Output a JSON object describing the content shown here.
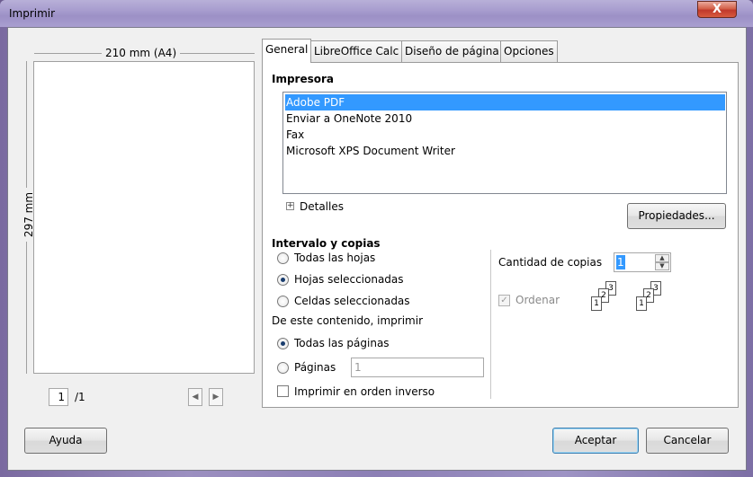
{
  "window": {
    "title": "Imprimir",
    "close_label": "X"
  },
  "preview": {
    "width_label": "210 mm (A4)",
    "height_label": "297 mm",
    "page_current": "1",
    "page_total": "/1",
    "prev_icon": "chevron-left-icon",
    "next_icon": "chevron-right-icon"
  },
  "tabs": [
    {
      "label": "General"
    },
    {
      "label": "LibreOffice Calc"
    },
    {
      "label": "Diseño de página"
    },
    {
      "label": "Opciones"
    }
  ],
  "printer": {
    "heading": "Impresora",
    "items": [
      {
        "label": "Adobe PDF",
        "selected": true
      },
      {
        "label": "Enviar a OneNote 2010"
      },
      {
        "label": "Fax"
      },
      {
        "label": "Microsoft XPS Document Writer"
      }
    ],
    "details_label": "Detalles",
    "properties_label": "Propiedades..."
  },
  "range": {
    "heading": "Intervalo y copias",
    "options": [
      {
        "label": "Todas las hojas"
      },
      {
        "label": "Hojas seleccionadas",
        "checked": true
      },
      {
        "label": "Celdas seleccionadas"
      }
    ],
    "content_heading": "De este contenido, imprimir",
    "content_options": [
      {
        "label": "Todas las páginas",
        "checked": true
      },
      {
        "label": "Páginas"
      }
    ],
    "pages_value": "1",
    "reverse_label": "Imprimir en orden inverso"
  },
  "copies": {
    "label": "Cantidad de copias",
    "value": "1",
    "collate_label": "Ordenar",
    "collate_check": "✓",
    "doc_numbers": [
      "1",
      "2",
      "3"
    ]
  },
  "footer": {
    "help_label": "Ayuda",
    "ok_label": "Aceptar",
    "cancel_label": "Cancelar"
  }
}
